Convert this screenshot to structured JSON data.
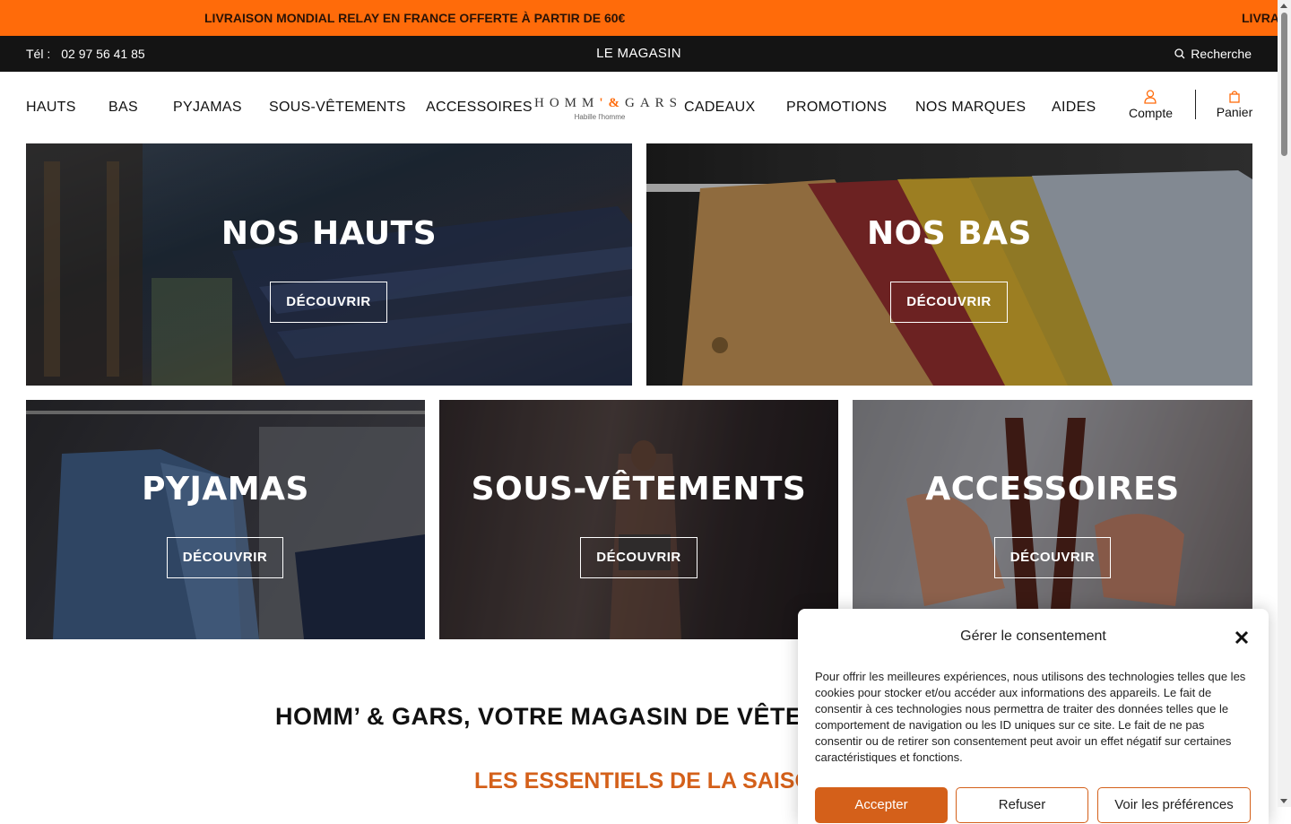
{
  "promo": {
    "text": "LIVRAISON MONDIAL RELAY EN FRANCE OFFERTE À PARTIR DE 60€",
    "text_repeat": "LIVRA"
  },
  "topbar": {
    "tel_label": "Tél :",
    "tel_number": "02 97 56 41 85",
    "shop_link": "LE MAGASIN",
    "search_label": "Recherche"
  },
  "nav": {
    "left": [
      "HAUTS",
      "BAS",
      "PYJAMAS",
      "SOUS-VÊTEMENTS",
      "ACCESSOIRES"
    ],
    "right": [
      "CADEAUX",
      "PROMOTIONS",
      "NOS MARQUES",
      "AIDES"
    ],
    "logo_text": "HOMM'&GARS",
    "logo_word1": "HOMM",
    "logo_amp": "'&",
    "logo_word2": "GARS",
    "logo_tagline": "Habille l'homme",
    "account_label": "Compte",
    "cart_label": "Panier"
  },
  "tiles": [
    {
      "title": "NOS HAUTS",
      "button": "DÉCOUVRIR"
    },
    {
      "title": "NOS BAS",
      "button": "DÉCOUVRIR"
    },
    {
      "title": "PYJAMAS",
      "button": "DÉCOUVRIR"
    },
    {
      "title": "SOUS-VÊTEMENTS",
      "button": "DÉCOUVRIR"
    },
    {
      "title": "ACCESSOIRES",
      "button": "DÉCOUVRIR"
    }
  ],
  "headline": "HOMM’ & GARS, VOTRE MAGASIN DE VÊTEMENTS",
  "subheadline": "LES ESSENTIELS DE LA SAISON",
  "consent": {
    "title": "Gérer le consentement",
    "body": "Pour offrir les meilleures expériences, nous utilisons des technologies telles que les cookies pour stocker et/ou accéder aux informations des appareils. Le fait de consentir à ces technologies nous permettra de traiter des données telles que le comportement de navigation ou les ID uniques sur ce site. Le fait de ne pas consentir ou de retirer son consentement peut avoir un effet négatif sur certaines caractéristiques et fonctions.",
    "accept": "Accepter",
    "refuse": "Refuser",
    "preferences": "Voir les préférences"
  },
  "colors": {
    "accent": "#ff6b0a",
    "accent_dark": "#d4601a",
    "topbar": "#141414"
  }
}
